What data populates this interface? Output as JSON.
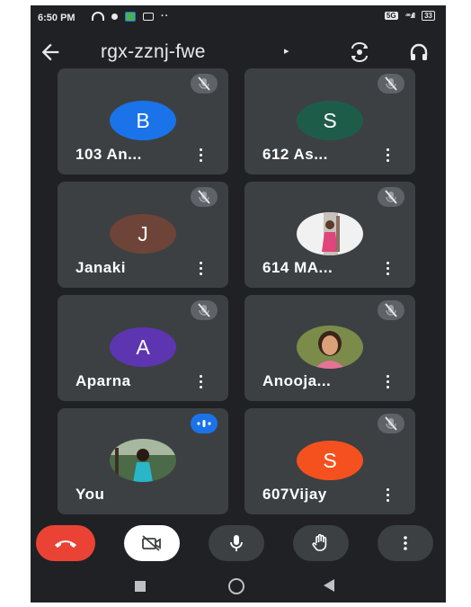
{
  "status_bar": {
    "time": "6:50 PM",
    "more": "··",
    "data_label": "5G",
    "signal": "⁴⁶.ıll",
    "battery": "33"
  },
  "header": {
    "meeting_code": "rgx-zznj-fwe"
  },
  "participants": [
    {
      "name": "103 An...",
      "initial": "B",
      "avatar_color": "#1a73e8",
      "muted": true
    },
    {
      "name": "612 As...",
      "initial": "S",
      "avatar_color": "#1e5c4a",
      "muted": true
    },
    {
      "name": "Janaki",
      "initial": "J",
      "avatar_color": "#6d4437",
      "muted": true
    },
    {
      "name": "614 MA...",
      "initial": "",
      "avatar_color": "",
      "photo": true,
      "muted": true
    },
    {
      "name": "Aparna",
      "initial": "A",
      "avatar_color": "#5e35b1",
      "muted": true
    },
    {
      "name": "Anooja...",
      "initial": "",
      "avatar_color": "",
      "photo": true,
      "muted": true
    },
    {
      "name": "You",
      "initial": "",
      "avatar_color": "",
      "photo": true,
      "muted": false,
      "speaking": true
    },
    {
      "name": "607Vijay",
      "initial": "S",
      "avatar_color": "#f4511e",
      "muted": true
    }
  ],
  "colors": {
    "background": "#202124",
    "tile": "#3c4043",
    "end_call": "#ea4335",
    "speaking_badge": "#1a73e8"
  }
}
